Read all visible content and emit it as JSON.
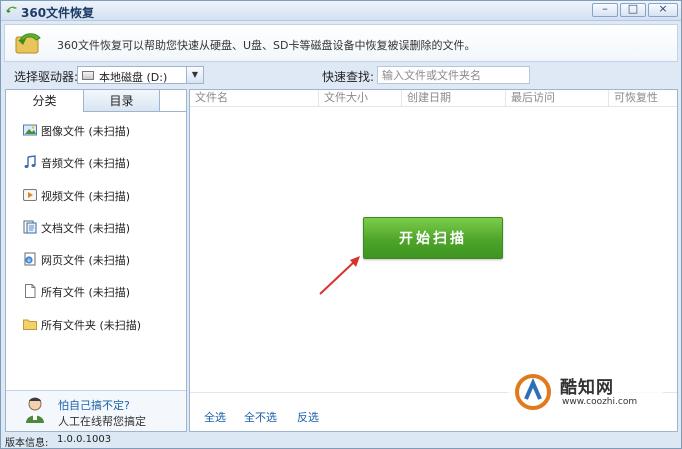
{
  "window": {
    "title": "360文件恢复",
    "minimize_glyph": "–",
    "maximize_glyph": "□",
    "close_glyph": "×"
  },
  "info": {
    "text": "360文件恢复可以帮助您快速从硬盘、U盘、SD卡等磁盘设备中恢复被误删除的文件。"
  },
  "drive": {
    "label": "选择驱动器:",
    "selected": "本地磁盘 (D:)"
  },
  "search": {
    "label": "快速查找:",
    "placeholder": "输入文件或文件夹名"
  },
  "tabs": [
    {
      "label": "分类"
    },
    {
      "label": "目录"
    }
  ],
  "categories": [
    {
      "label": "图像文件 (未扫描)",
      "icon": "image-icon"
    },
    {
      "label": "音频文件 (未扫描)",
      "icon": "music-note-icon"
    },
    {
      "label": "视频文件 (未扫描)",
      "icon": "video-icon"
    },
    {
      "label": "文档文件 (未扫描)",
      "icon": "document-icon"
    },
    {
      "label": "网页文件 (未扫描)",
      "icon": "webpage-icon"
    },
    {
      "label": "所有文件 (未扫描)",
      "icon": "file-icon"
    },
    {
      "label": "所有文件夹 (未扫描)",
      "icon": "folder-icon"
    }
  ],
  "help": {
    "link": "怕自己搞不定?",
    "text": "人工在线帮您搞定"
  },
  "table": {
    "columns": [
      "文件名",
      "文件大小",
      "创建日期",
      "最后访问",
      "可恢复性"
    ]
  },
  "scan_button": "开始扫描",
  "actions": {
    "select_all": "全选",
    "select_none": "全不选",
    "invert": "反选"
  },
  "watermark": {
    "name": "酷知网",
    "url": "www.coozhi.com"
  },
  "status": {
    "version_label": "版本信息:",
    "version": "1.0.0.1003"
  },
  "colors": {
    "accent_green": "#4fa52a",
    "link_blue": "#1a5fa8",
    "arrow_red": "#d8322b"
  }
}
